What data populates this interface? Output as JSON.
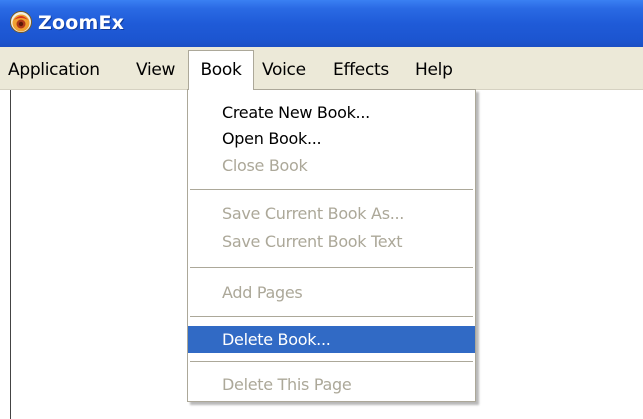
{
  "window": {
    "title": "ZoomEx",
    "icon": "zoomex-app-icon",
    "titlebar_color": "#1f5bd8"
  },
  "menubar": {
    "items": [
      {
        "label": "Application"
      },
      {
        "label": "View"
      },
      {
        "label": "Book",
        "open": true
      },
      {
        "label": "Voice"
      },
      {
        "label": "Effects"
      },
      {
        "label": "Help"
      }
    ]
  },
  "book_menu": {
    "items": [
      {
        "label": "Create New Book...",
        "enabled": true
      },
      {
        "label": "Open Book...",
        "enabled": true
      },
      {
        "label": "Close Book",
        "enabled": false
      },
      {
        "label": "Save Current Book As...",
        "enabled": false
      },
      {
        "label": "Save Current Book Text",
        "enabled": false
      },
      {
        "label": "Add Pages",
        "enabled": false
      },
      {
        "label": "Delete Book...",
        "enabled": true,
        "highlighted": true
      },
      {
        "label": "Delete This Page",
        "enabled": false
      }
    ],
    "highlight_color": "#316ac5",
    "disabled_color": "#aca899"
  }
}
